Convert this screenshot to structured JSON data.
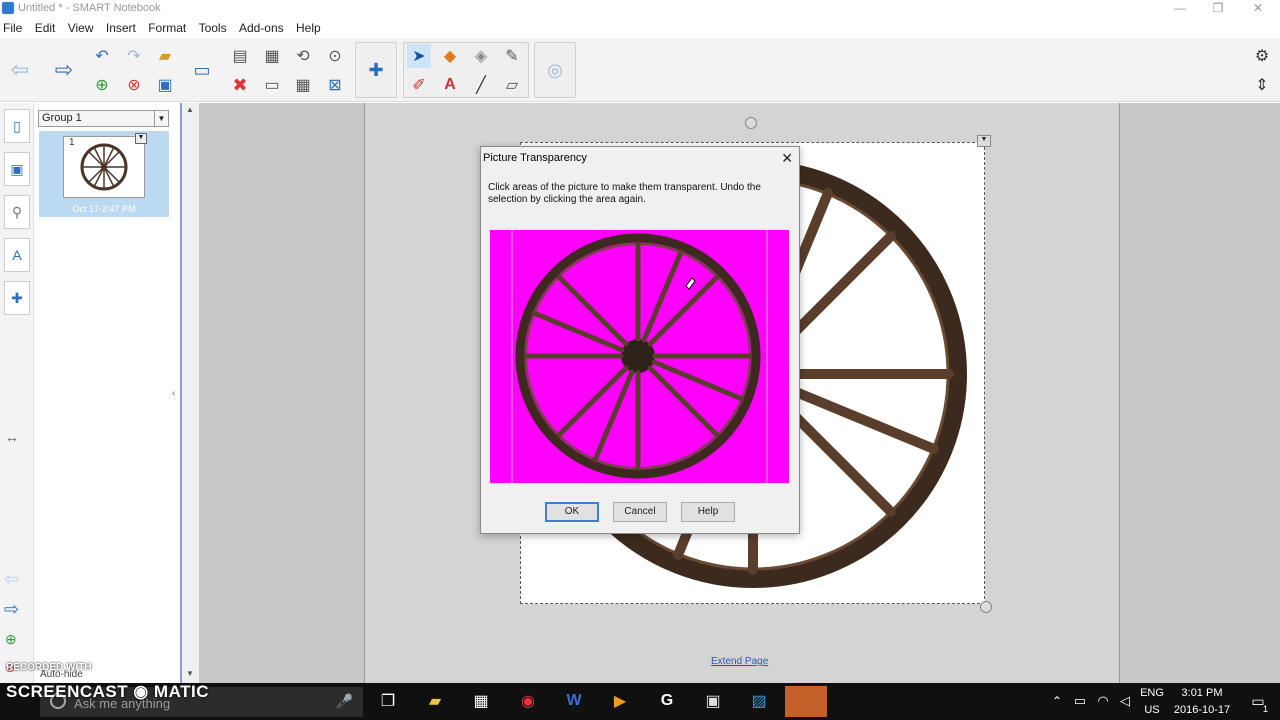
{
  "window": {
    "title": "Untitled * - SMART Notebook",
    "minimize": "—",
    "restore": "❐",
    "close": "✕"
  },
  "menu": [
    "File",
    "Edit",
    "View",
    "Insert",
    "Format",
    "Tools",
    "Add-ons",
    "Help"
  ],
  "sorter": {
    "group_label": "Group 1",
    "page_number": "1",
    "page_date": "Oct 17-2:47 PM"
  },
  "canvas": {
    "extend_link": "Extend Page"
  },
  "dialog": {
    "title": "Picture Transparency",
    "instructions": "Click areas of the picture to make them transparent. Undo the selection by clicking the area again.",
    "ok_label": "OK",
    "cancel_label": "Cancel",
    "help_label": "Help",
    "preview_bg": "#ff00ff"
  },
  "watermark": {
    "line1": "RECORDED WITH",
    "line2": "SCREENCAST ◉ MATIC"
  },
  "sidebar_bottom": {
    "auto_hide_label": "Auto-hide"
  },
  "taskbar": {
    "search_placeholder": "Ask me anything",
    "lang_top": "ENG",
    "lang_bottom": "US",
    "time": "3:01 PM",
    "date": "2016-10-17",
    "notification_count": "1"
  },
  "colors": {
    "accent": "#2e6fba",
    "selection": "#bcd9f2",
    "magenta": "#ff00ff"
  }
}
